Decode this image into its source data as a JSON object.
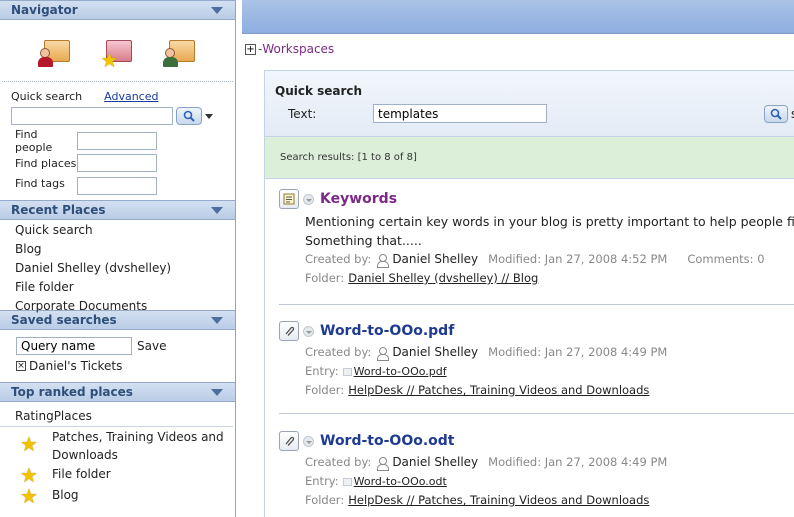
{
  "sidebar": {
    "navigator": {
      "title": "Navigator",
      "icons": [
        "my-home-icon",
        "favorites-icon",
        "my-workspace-icon"
      ]
    },
    "quick_search": {
      "label": "Quick search",
      "advanced": "Advanced",
      "value": ""
    },
    "find": [
      {
        "label": "Find people",
        "value": ""
      },
      {
        "label": "Find places",
        "value": ""
      },
      {
        "label": "Find tags",
        "value": ""
      }
    ],
    "recent_places": {
      "title": "Recent Places",
      "items": [
        "Quick search",
        "Blog",
        "Daniel Shelley (dvshelley)",
        "File folder",
        "Corporate Documents"
      ]
    },
    "saved_searches": {
      "title": "Saved searches",
      "query_value": "Query name",
      "save_label": "Save",
      "items": [
        "Daniel's Tickets"
      ]
    },
    "top_ranked": {
      "title": "Top ranked places",
      "header": "RatingPlaces",
      "items": [
        {
          "line1": "Patches, Training Videos and",
          "line2": "Downloads"
        },
        {
          "line1": "File folder",
          "line2": ""
        },
        {
          "line1": "Blog",
          "line2": ""
        }
      ]
    }
  },
  "main": {
    "workspaces": "Workspaces",
    "quick_search": {
      "title": "Quick search",
      "text_label": "Text:",
      "text_value": "templates",
      "cut_label": "s"
    },
    "results_summary": "Search results: [1 to 8 of 8]",
    "results": [
      {
        "title": "Keywords",
        "desc1": "Mentioning certain key words in your blog is pretty important to help people find y",
        "desc2": "Something that.....",
        "created_label": "Created by:",
        "author": "Daniel Shelley",
        "modified": "Modified: Jan 27, 2008 4:52 PM",
        "comments": "Comments: 0",
        "entry_label": "",
        "entry": "",
        "folder_label": "Folder:",
        "folder": "Daniel Shelley (dvshelley) // Blog"
      },
      {
        "title": "Word-to-OOo.pdf",
        "created_label": "Created by:",
        "author": "Daniel Shelley",
        "modified": "Modified: Jan 27, 2008 4:49 PM",
        "entry_label": "Entry:",
        "entry": "Word-to-OOo.pdf",
        "folder_label": "Folder:",
        "folder": "HelpDesk // Patches, Training Videos and Downloads"
      },
      {
        "title": "Word-to-OOo.odt",
        "created_label": "Created by:",
        "author": "Daniel Shelley",
        "modified": "Modified: Jan 27, 2008 4:49 PM",
        "entry_label": "Entry:",
        "entry": "Word-to-OOo.odt",
        "folder_label": "Folder:",
        "folder": "HelpDesk // Patches, Training Videos and Downloads"
      }
    ]
  },
  "colors": {
    "header_blue": "#8eaee0",
    "results_green": "#dbefd9",
    "title_purple": "#7b2a86",
    "title_blue": "#1e3b92"
  }
}
